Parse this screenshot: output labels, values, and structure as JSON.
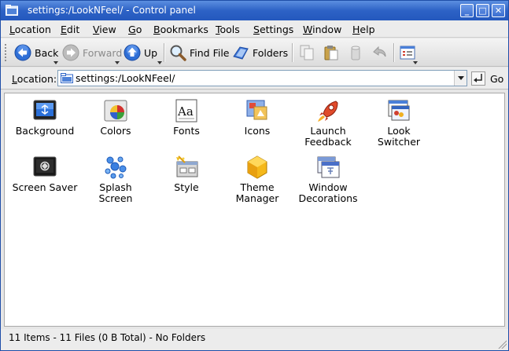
{
  "window": {
    "title": "settings:/LookNFeel/ - Control panel",
    "controls": {
      "minimize": "_",
      "maximize": "□",
      "close": "✕"
    }
  },
  "menubar": {
    "items": [
      {
        "underline": "L",
        "rest": "ocation"
      },
      {
        "underline": "E",
        "rest": "dit"
      },
      {
        "underline": "V",
        "rest": "iew"
      },
      {
        "underline": "G",
        "rest": "o"
      },
      {
        "underline": "B",
        "rest": "ookmarks"
      },
      {
        "underline": "T",
        "rest": "ools"
      },
      {
        "underline": "S",
        "rest": "ettings"
      },
      {
        "underline": "W",
        "rest": "indow"
      },
      {
        "underline": "H",
        "rest": "elp"
      }
    ]
  },
  "toolbar": {
    "back": "Back",
    "forward": "Forward",
    "up": "Up",
    "find_file": "Find File",
    "folders": "Folders",
    "icons": {
      "back": "back-arrow-icon",
      "forward": "forward-arrow-icon",
      "up": "up-arrow-icon",
      "find": "magnifier-icon",
      "folders": "folder-tree-icon",
      "copy": "copy-icon",
      "paste": "paste-icon",
      "trash": "trash-icon",
      "undo": "undo-icon",
      "view": "view-mode-icon"
    }
  },
  "location": {
    "label_underline": "L",
    "label_rest": "ocation:",
    "value": "settings:/LookNFeel/",
    "go": "Go"
  },
  "items": [
    {
      "label": "Background",
      "icon": "background-icon"
    },
    {
      "label": "Colors",
      "icon": "colors-icon"
    },
    {
      "label": "Fonts",
      "icon": "fonts-icon"
    },
    {
      "label": "Icons",
      "icon": "icons-icon"
    },
    {
      "label": "Launch\nFeedback",
      "icon": "rocket-icon"
    },
    {
      "label": "Look\nSwitcher",
      "icon": "look-switcher-icon"
    },
    {
      "label": "Screen Saver",
      "icon": "screen-saver-icon"
    },
    {
      "label": "Splash\nScreen",
      "icon": "splash-screen-icon"
    },
    {
      "label": "Style",
      "icon": "style-icon"
    },
    {
      "label": "Theme\nManager",
      "icon": "theme-manager-icon"
    },
    {
      "label": "Window\nDecorations",
      "icon": "window-decorations-icon"
    }
  ],
  "status": {
    "text": "11 Items - 11 Files (0 B Total) - No Folders"
  },
  "colors": {
    "titlebar": "#2d62c6",
    "accent": "#3a6dd0"
  }
}
